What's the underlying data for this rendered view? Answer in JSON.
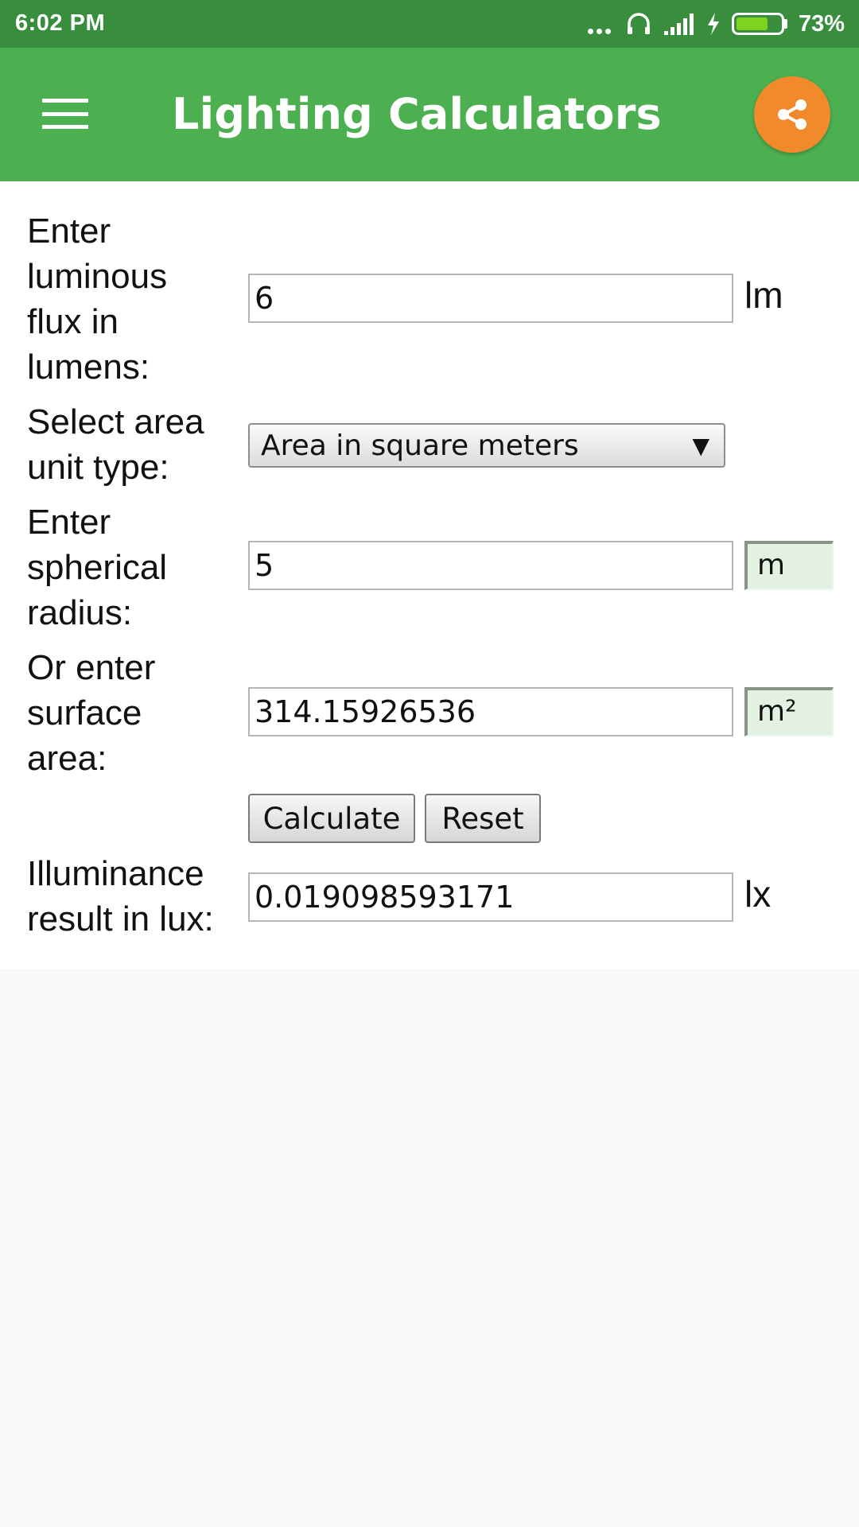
{
  "status_bar": {
    "time": "6:02 PM",
    "battery_percent_label": "73%",
    "battery_level": 0.73
  },
  "app_bar": {
    "title": "Lighting Calculators",
    "menu_icon": "hamburger-menu-icon",
    "share_icon": "share-icon",
    "share_color": "#f08a2a",
    "bar_color": "#4caf50"
  },
  "form": {
    "flux": {
      "label_lines": [
        "Enter",
        "luminous",
        "flux in",
        "lumens:"
      ],
      "value": "6",
      "unit": "lm"
    },
    "area_unit": {
      "label_lines": [
        "Select area",
        "unit type:"
      ],
      "selected": "Area in square meters"
    },
    "radius": {
      "label_lines": [
        "Enter",
        "spherical",
        "radius:"
      ],
      "value": "5",
      "unit": "m"
    },
    "surface_area": {
      "label_lines": [
        "Or enter",
        "surface",
        "area:"
      ],
      "value": "314.15926536",
      "unit": "m²"
    },
    "buttons": {
      "calculate": "Calculate",
      "reset": "Reset"
    },
    "result": {
      "label_lines": [
        "Illuminance",
        "result in lux:"
      ],
      "value": "0.019098593171",
      "unit": "lx"
    }
  }
}
